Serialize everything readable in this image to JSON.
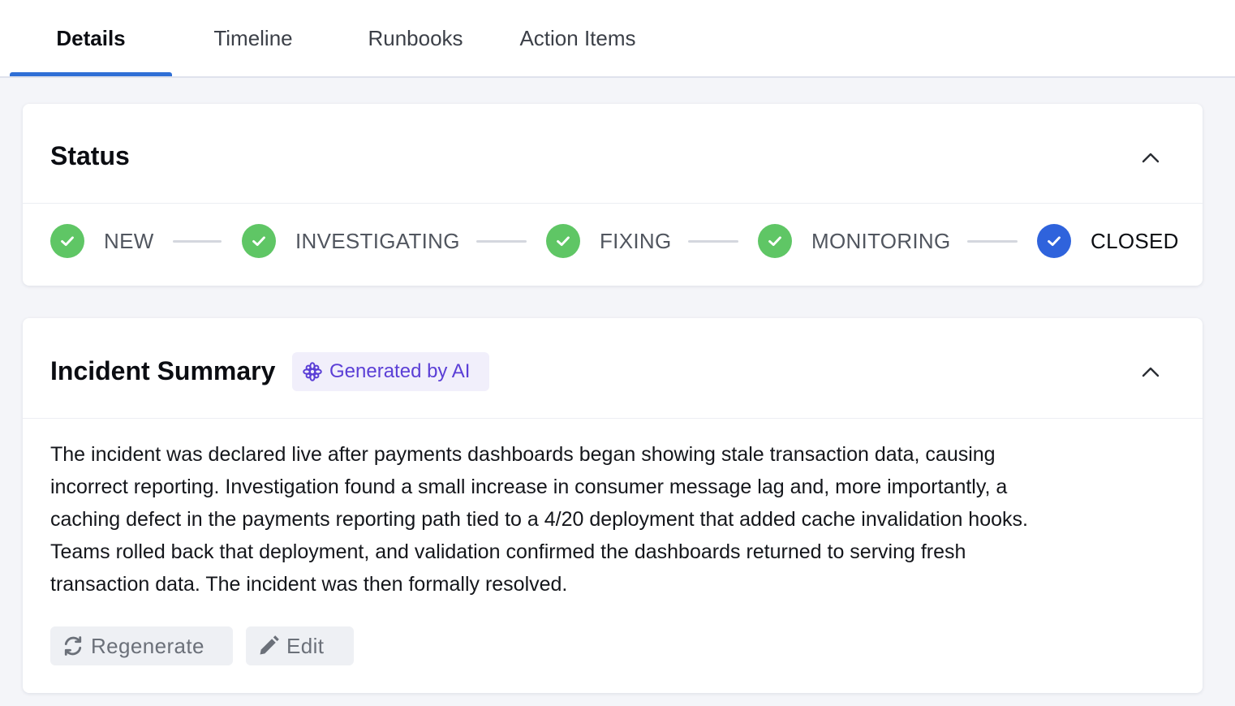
{
  "tabs": [
    {
      "label": "Details",
      "active": true
    },
    {
      "label": "Timeline",
      "active": false
    },
    {
      "label": "Runbooks",
      "active": false
    },
    {
      "label": "Action Items",
      "active": false
    }
  ],
  "status_card": {
    "title": "Status",
    "steps": [
      {
        "label": "NEW",
        "state": "done"
      },
      {
        "label": "INVESTIGATING",
        "state": "done"
      },
      {
        "label": "FIXING",
        "state": "done"
      },
      {
        "label": "MONITORING",
        "state": "done"
      },
      {
        "label": "CLOSED",
        "state": "current"
      }
    ]
  },
  "summary_card": {
    "title": "Incident Summary",
    "badge": "Generated by AI",
    "lines": [
      "The incident was declared live after payments dashboards began showing stale transaction data, causing",
      "incorrect reporting. Investigation found a small increase in consumer message lag and, more importantly, a",
      "caching defect in the payments reporting path tied to a 4/20 deployment that added cache invalidation hooks.",
      "Teams rolled back that deployment, and validation confirmed the dashboards returned to serving fresh",
      "transaction data. The incident was then formally resolved."
    ],
    "regenerate_label": "Regenerate",
    "edit_label": "Edit"
  },
  "colors": {
    "accent": "#2f6fd6",
    "step_done": "#5fc665",
    "step_current": "#2f63dc",
    "ai_purple": "#5b3fd6"
  },
  "icons": {
    "step_done": "check-circle-icon",
    "step_current": "check-circle-icon",
    "collapse": "chevron-up-icon",
    "ai": "sparkle-icon",
    "regenerate": "refresh-icon",
    "edit": "pencil-icon"
  }
}
